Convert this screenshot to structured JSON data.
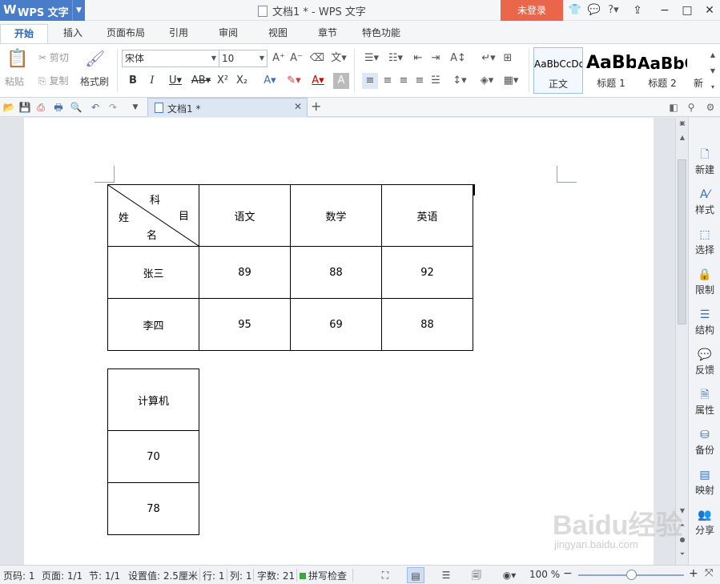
{
  "app": {
    "logo": "W",
    "name": "WPS 文字",
    "window_title": "文档1 * - WPS 文字",
    "login_label": "未登录"
  },
  "tabs": [
    "开始",
    "插入",
    "页面布局",
    "引用",
    "审阅",
    "视图",
    "章节",
    "特色功能"
  ],
  "ribbon": {
    "paste": "粘贴",
    "cut": "剪切",
    "copy": "复制",
    "format_painter": "格式刷",
    "font_name": "宋体",
    "font_size": "10",
    "styles": [
      {
        "sample": "AaBbCcDd",
        "name": "正文"
      },
      {
        "sample": "AaBb",
        "name": "标题 1"
      },
      {
        "sample": "AaBbC",
        "name": "标题 2"
      },
      {
        "sample": "",
        "name": "新"
      }
    ]
  },
  "document_tab": {
    "label": "文档1 *"
  },
  "table1": {
    "diag": {
      "top": "科",
      "right": "目",
      "left": "姓",
      "bottom": "名"
    },
    "headers": [
      "语文",
      "数学",
      "英语"
    ],
    "rows": [
      {
        "name": "张三",
        "scores": [
          "89",
          "88",
          "92"
        ]
      },
      {
        "name": "李四",
        "scores": [
          "95",
          "69",
          "88"
        ]
      }
    ]
  },
  "table2": {
    "header": "计算机",
    "values": [
      "70",
      "78"
    ]
  },
  "right_panel": [
    "新建",
    "样式",
    "选择",
    "限制",
    "结构",
    "反馈",
    "属性",
    "备份",
    "映射",
    "分享"
  ],
  "status": {
    "page_code": "页码: 1",
    "page": "页面: 1/1",
    "section": "节: 1/1",
    "setting": "设置值: 2.5厘米",
    "line": "行: 1",
    "column": "列: 1",
    "word_count": "字数: 21",
    "spell_check": "拼写检查",
    "zoom": "100 %"
  },
  "watermark": {
    "text": "Baidu经验",
    "url": "jingyan.baidu.com"
  },
  "colors": {
    "accent": "#4a7dc9",
    "login": "#e9664a"
  }
}
